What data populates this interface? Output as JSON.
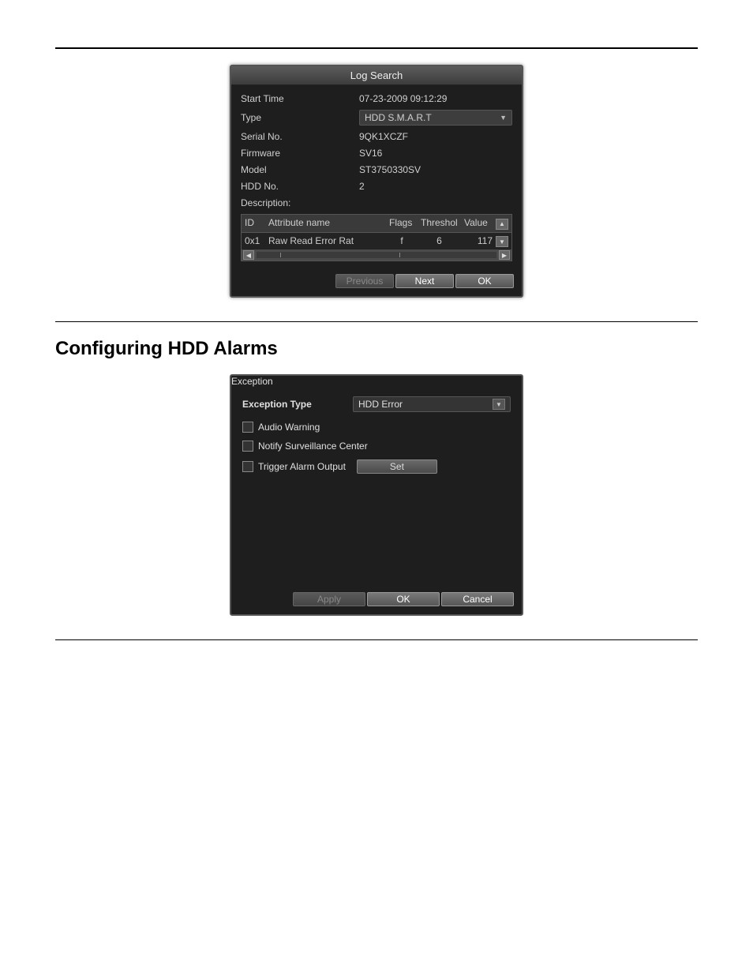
{
  "logSearch": {
    "title": "Log Search",
    "fields": {
      "startTimeLabel": "Start Time",
      "startTimeValue": "07-23-2009 09:12:29",
      "typeLabel": "Type",
      "typeValue": "HDD S.M.A.R.T",
      "serialLabel": "Serial No.",
      "serialValue": "9QK1XCZF",
      "firmwareLabel": "Firmware",
      "firmwareValue": "SV16",
      "modelLabel": "Model",
      "modelValue": "ST3750330SV",
      "hddNoLabel": "HDD No.",
      "hddNoValue": "2",
      "descriptionLabel": "Description:"
    },
    "table": {
      "headers": {
        "id": "ID",
        "attr": "Attribute name",
        "flags": "Flags",
        "threshold": "Threshol",
        "value": "Value"
      },
      "row": {
        "id": "0x1",
        "attr": "Raw Read Error Rat",
        "flags": "f",
        "threshold": "6",
        "value": "117"
      }
    },
    "buttons": {
      "previous": "Previous",
      "next": "Next",
      "ok": "OK"
    }
  },
  "sectionTitle": "Configuring HDD Alarms",
  "exception": {
    "title": "Exception",
    "typeLabel": "Exception Type",
    "typeValue": "HDD Error",
    "audioWarning": "Audio Warning",
    "notifyCenter": "Notify Surveillance Center",
    "triggerAlarm": "Trigger Alarm Output",
    "setLabel": "Set",
    "buttons": {
      "apply": "Apply",
      "ok": "OK",
      "cancel": "Cancel"
    }
  }
}
